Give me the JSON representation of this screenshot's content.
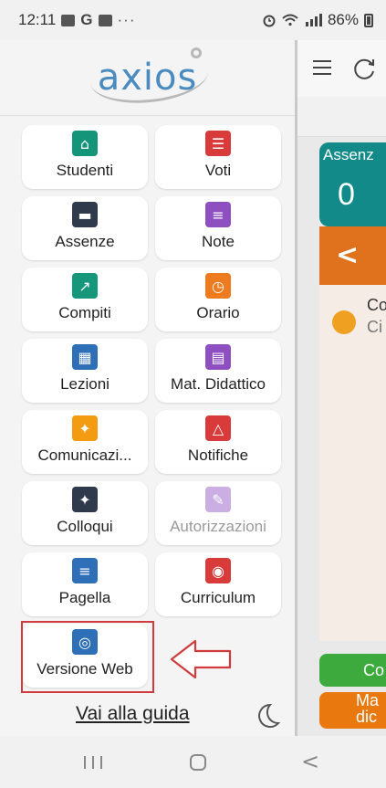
{
  "status_bar": {
    "time": "12:11",
    "g_label": "G",
    "more": "···",
    "battery": "86%"
  },
  "drawer": {
    "logo_text": "axios",
    "tiles": [
      {
        "label": "Studenti",
        "icon": "graduation-icon",
        "color": "#14957a",
        "disabled": false
      },
      {
        "label": "Voti",
        "icon": "clipboard-grades-icon",
        "color": "#d93a3a",
        "disabled": false
      },
      {
        "label": "Assenze",
        "icon": "bed-icon",
        "color": "#2f3b4c",
        "disabled": false
      },
      {
        "label": "Note",
        "icon": "note-icon",
        "color": "#8e4fc1",
        "disabled": false
      },
      {
        "label": "Compiti",
        "icon": "chalkboard-icon",
        "color": "#16967a",
        "disabled": false
      },
      {
        "label": "Orario",
        "icon": "clock-icon",
        "color": "#ee7b1e",
        "disabled": false
      },
      {
        "label": "Lezioni",
        "icon": "teacher-board-icon",
        "color": "#2e6fb7",
        "disabled": false
      },
      {
        "label": "Mat. Didattico",
        "icon": "books-icon",
        "color": "#8e4fc1",
        "disabled": false
      },
      {
        "label": "Comunicazi...",
        "icon": "pdf-icon",
        "color": "#f39c12",
        "disabled": false
      },
      {
        "label": "Notifiche",
        "icon": "bell-icon",
        "color": "#d93a3a",
        "disabled": false
      },
      {
        "label": "Colloqui",
        "icon": "meeting-icon",
        "color": "#2f3b4c",
        "disabled": false
      },
      {
        "label": "Autorizzazioni",
        "icon": "authorization-icon",
        "color": "#8e4fc1",
        "disabled": true
      },
      {
        "label": "Pagella",
        "icon": "report-card-icon",
        "color": "#2e6fb7",
        "disabled": false
      },
      {
        "label": "Curriculum",
        "icon": "certificate-icon",
        "color": "#d93a3a",
        "disabled": false
      },
      {
        "label": "Versione Web",
        "icon": "globe-icon",
        "color": "#2e6fb7",
        "disabled": false
      }
    ],
    "guide_link": "Vai alla guida"
  },
  "app": {
    "assenze_title": "Assenz",
    "assenze_count": "0",
    "chevron": "<",
    "list_line1": "Co",
    "list_line2": "Ci",
    "green_button": "Co",
    "orange_button_line1": "Ma",
    "orange_button_line2": "dic"
  }
}
